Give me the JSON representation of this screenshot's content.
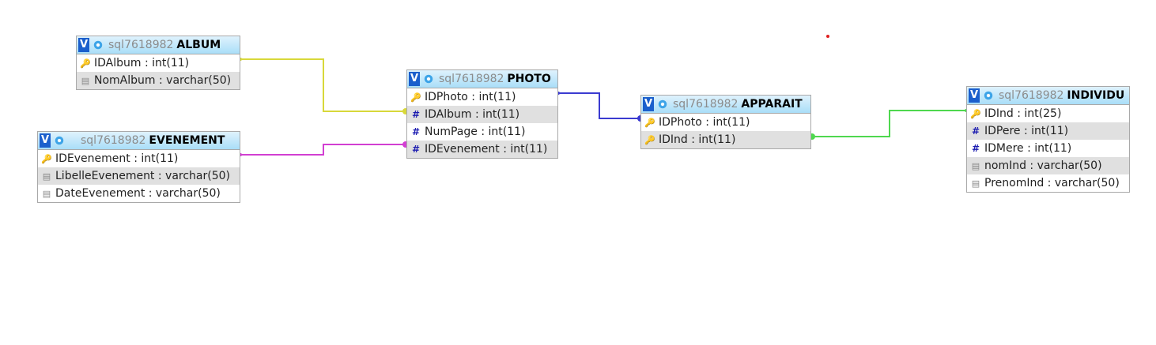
{
  "colors": {
    "album_link": "#d8d83a",
    "evenement_link": "#d23fd2",
    "photo_link": "#3b3bd0",
    "individu_link": "#4fd84f",
    "header_gradient_top": "#dff2fd",
    "header_gradient_bottom": "#a9def8"
  },
  "tables": {
    "album": {
      "db": "sql7618982",
      "name": "ALBUM",
      "columns": [
        {
          "label": "IDAlbum : int(11)",
          "icon": "key-icon"
        },
        {
          "label": "NomAlbum : varchar(50)",
          "icon": "text-field-icon"
        }
      ]
    },
    "evenement": {
      "db": "sql7618982",
      "name": "EVENEMENT",
      "columns": [
        {
          "label": "IDEvenement : int(11)",
          "icon": "key-icon"
        },
        {
          "label": "LibelleEvenement : varchar(50)",
          "icon": "text-field-icon"
        },
        {
          "label": "DateEvenement : varchar(50)",
          "icon": "text-field-icon"
        }
      ]
    },
    "photo": {
      "db": "sql7618982",
      "name": "PHOTO",
      "columns": [
        {
          "label": "IDPhoto : int(11)",
          "icon": "key-icon"
        },
        {
          "label": "IDAlbum : int(11)",
          "icon": "hash-icon"
        },
        {
          "label": "NumPage : int(11)",
          "icon": "hash-icon"
        },
        {
          "label": "IDEvenement : int(11)",
          "icon": "hash-icon"
        }
      ]
    },
    "apparait": {
      "db": "sql7618982",
      "name": "APPARAIT",
      "columns": [
        {
          "label": "IDPhoto : int(11)",
          "icon": "key-icon"
        },
        {
          "label": "IDInd : int(11)",
          "icon": "key-icon"
        }
      ]
    },
    "individu": {
      "db": "sql7618982",
      "name": "INDIVIDU",
      "columns": [
        {
          "label": "IDInd : int(25)",
          "icon": "key-icon"
        },
        {
          "label": "IDPere : int(11)",
          "icon": "hash-icon"
        },
        {
          "label": "IDMere : int(11)",
          "icon": "hash-icon"
        },
        {
          "label": "nomInd : varchar(50)",
          "icon": "text-field-icon"
        },
        {
          "label": "PrenomInd : varchar(50)",
          "icon": "text-field-icon"
        }
      ]
    }
  },
  "toggle_label": "V"
}
